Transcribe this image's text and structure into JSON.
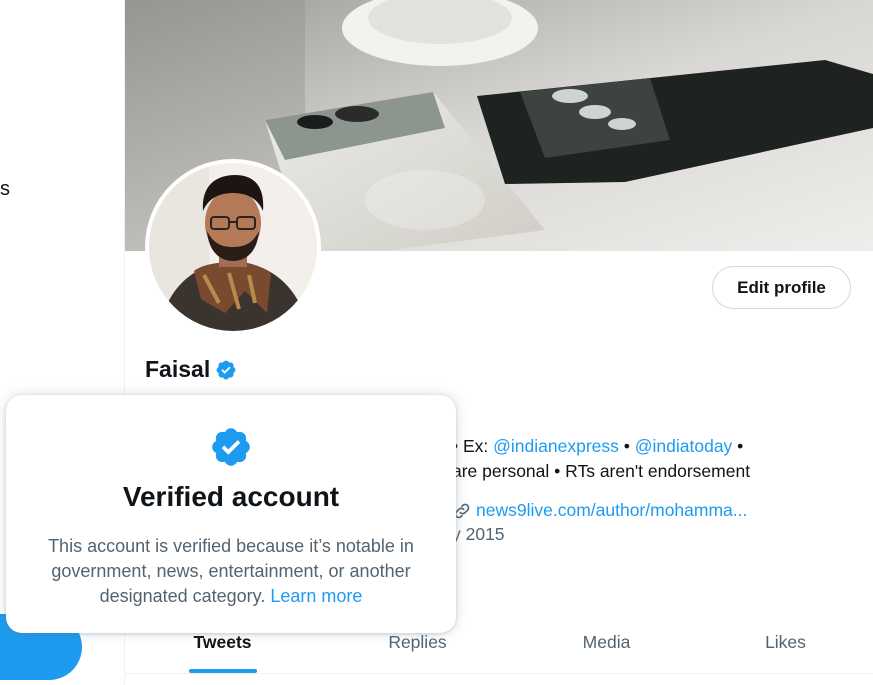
{
  "nav": {
    "fragment": "s"
  },
  "profile": {
    "display_name": "Faisal",
    "edit_label": "Edit profile"
  },
  "bio": {
    "line1_text": "• Ex: ",
    "mention1": "@indianexpress",
    "separator": " • ",
    "mention2": "@indiatoday",
    "line1_end": " •",
    "line2_text": "are personal • RTs aren't endorsement",
    "website": "news9live.com/author/mohamma...",
    "joined_fragment": "y 2015"
  },
  "tabs": [
    {
      "label": "Tweets",
      "active": true
    },
    {
      "label": "Replies",
      "active": false
    },
    {
      "label": "Media",
      "active": false
    },
    {
      "label": "Likes",
      "active": false
    }
  ],
  "popover": {
    "title": "Verified account",
    "description": "This account is verified because it’s notable in government, news, entertainment, or another designated category.",
    "link_label": "Learn more"
  },
  "colors": {
    "accent": "#1d9bf0",
    "text_primary": "#0f1419",
    "text_secondary": "#536471"
  }
}
